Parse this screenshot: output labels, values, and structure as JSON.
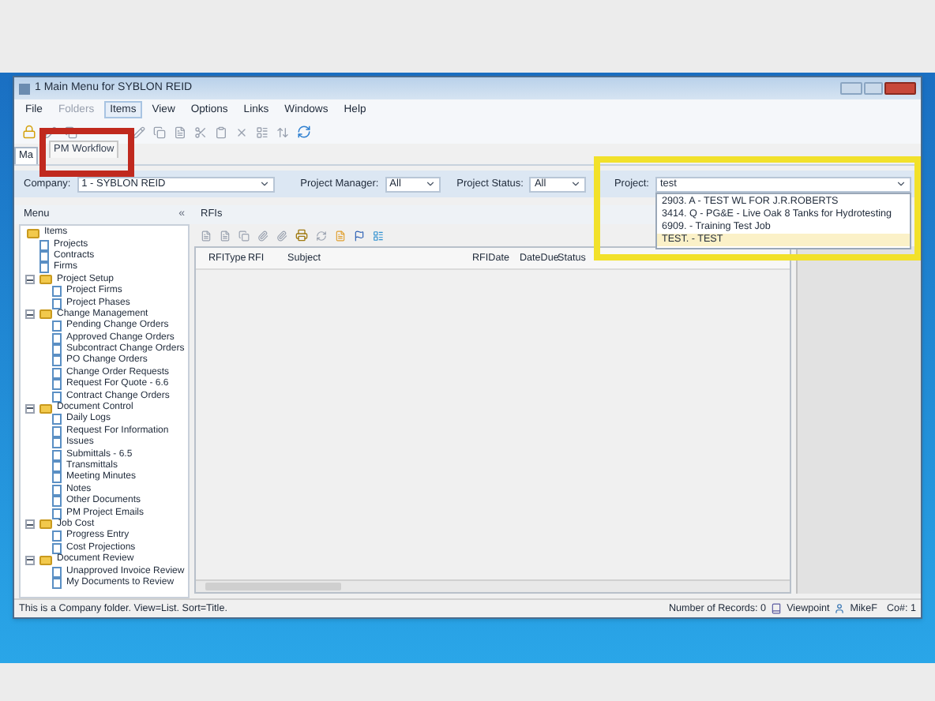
{
  "window": {
    "title": "1 Main Menu for SYBLON REID"
  },
  "menu_bar": [
    {
      "label": "File",
      "selected": false,
      "disabled": false
    },
    {
      "label": "Folders",
      "selected": false,
      "disabled": true
    },
    {
      "label": "Items",
      "selected": true,
      "disabled": false
    },
    {
      "label": "View",
      "selected": false,
      "disabled": false
    },
    {
      "label": "Options",
      "selected": false,
      "disabled": false
    },
    {
      "label": "Links",
      "selected": false,
      "disabled": false
    },
    {
      "label": "Windows",
      "selected": false,
      "disabled": false
    },
    {
      "label": "Help",
      "selected": false,
      "disabled": false
    }
  ],
  "tabs": [
    {
      "label": "Ma",
      "selected": true
    },
    {
      "label": "PM Workflow",
      "selected": false
    }
  ],
  "filters": [
    {
      "label": "Company:",
      "value": "1 - SYBLON REID"
    },
    {
      "label": "Project Manager:",
      "value": "All"
    },
    {
      "label": "Project Status:",
      "value": "All"
    }
  ],
  "project_filter": {
    "label": "Project:",
    "value": "test",
    "options": [
      {
        "label": "2903. A -  TEST WL FOR J.R.ROBERTS",
        "selected": false
      },
      {
        "label": "3414. Q -  PG&E - Live Oak 8 Tanks for Hydrotesting",
        "selected": false
      },
      {
        "label": "6909. -  Training Test Job",
        "selected": false
      },
      {
        "label": "TEST. -  TEST",
        "selected": true
      }
    ]
  },
  "menu_pane": {
    "title": "Menu",
    "collapse": "«",
    "tree": [
      {
        "label": "Items",
        "children": [
          {
            "label": "Projects"
          },
          {
            "label": "Contracts"
          },
          {
            "label": "Firms"
          },
          {
            "label": "Project Setup",
            "expanded": true,
            "children": [
              {
                "label": "Project Firms"
              },
              {
                "label": "Project Phases"
              }
            ]
          },
          {
            "label": "Change Management",
            "expanded": true,
            "children": [
              {
                "label": "Pending Change Orders"
              },
              {
                "label": "Approved Change Orders"
              },
              {
                "label": "Subcontract Change Orders"
              },
              {
                "label": "PO Change Orders"
              },
              {
                "label": "Change Order Requests"
              },
              {
                "label": "Request For Quote - 6.6"
              },
              {
                "label": "Contract Change Orders"
              }
            ]
          },
          {
            "label": "Document Control",
            "expanded": true,
            "children": [
              {
                "label": "Daily Logs"
              },
              {
                "label": "Request For Information"
              },
              {
                "label": "Issues"
              },
              {
                "label": "Submittals - 6.5"
              },
              {
                "label": "Transmittals"
              },
              {
                "label": "Meeting Minutes"
              },
              {
                "label": "Notes"
              },
              {
                "label": "Other Documents"
              },
              {
                "label": "PM Project Emails"
              }
            ]
          },
          {
            "label": "Job Cost",
            "expanded": true,
            "children": [
              {
                "label": "Progress Entry"
              },
              {
                "label": "Cost Projections"
              }
            ]
          },
          {
            "label": "Document Review",
            "expanded": true,
            "children": [
              {
                "label": "Unapproved Invoice Review"
              },
              {
                "label": "My Documents to Review"
              }
            ]
          }
        ]
      }
    ]
  },
  "rfis": {
    "title": "RFIs",
    "columns": [
      "RFIType",
      "RFI",
      "Subject",
      "RFIDate",
      "DateDue",
      "Status"
    ]
  },
  "status_bar": {
    "message": "This is a Company folder. View=List. Sort=Title.",
    "records": "Number of Records: 0",
    "product": "Viewpoint",
    "user": "MikeF",
    "company": "Co#: 1"
  }
}
